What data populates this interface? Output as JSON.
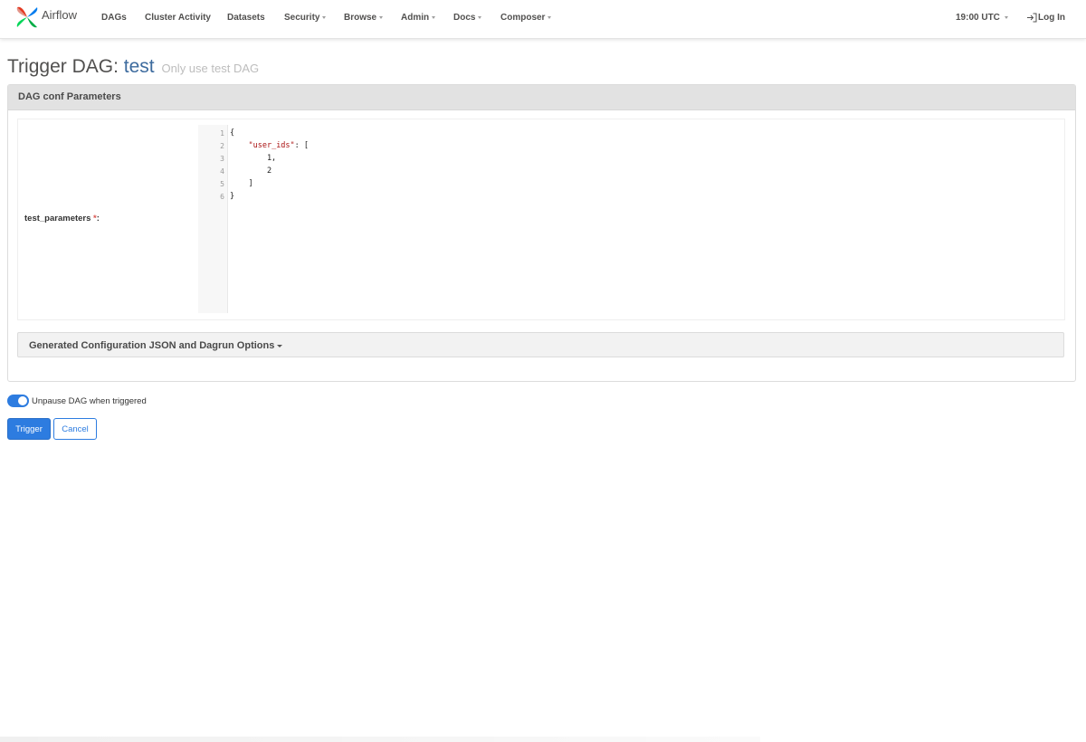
{
  "nav": {
    "brand": "Airflow",
    "items": [
      {
        "label": "DAGs"
      },
      {
        "label": "Cluster Activity"
      },
      {
        "label": "Datasets"
      },
      {
        "label": "Security"
      },
      {
        "label": "Browse"
      },
      {
        "label": "Admin"
      },
      {
        "label": "Docs"
      },
      {
        "label": "Composer"
      }
    ],
    "time": "19:00 UTC",
    "login": "Log In"
  },
  "page": {
    "title_prefix": "Trigger DAG:",
    "dag_id": "test",
    "description": "Only use test DAG"
  },
  "panel": {
    "heading": "DAG conf Parameters",
    "param_label": "test_parameters",
    "required_mark": "*",
    "label_suffix": ":",
    "editor": {
      "line_numbers": [
        "1",
        "2",
        "3",
        "4",
        "5",
        "6"
      ],
      "lines": [
        {
          "plain": "{",
          "str": "",
          "after": ""
        },
        {
          "plain": "    ",
          "str": "\"user_ids\"",
          "after": ": ["
        },
        {
          "plain": "        1,",
          "str": "",
          "after": ""
        },
        {
          "plain": "        2",
          "str": "",
          "after": ""
        },
        {
          "plain": "    ]",
          "str": "",
          "after": ""
        },
        {
          "plain": "}",
          "str": "",
          "after": ""
        }
      ]
    },
    "generated_config": "Generated Configuration JSON and Dagrun Options"
  },
  "toggle": {
    "label": "Unpause DAG when triggered",
    "on": true
  },
  "buttons": {
    "trigger": "Trigger",
    "cancel": "Cancel"
  },
  "colors": {
    "accent": "#2d7ce0",
    "required": "#d9534f",
    "dag_id": "#3d6b9e"
  }
}
